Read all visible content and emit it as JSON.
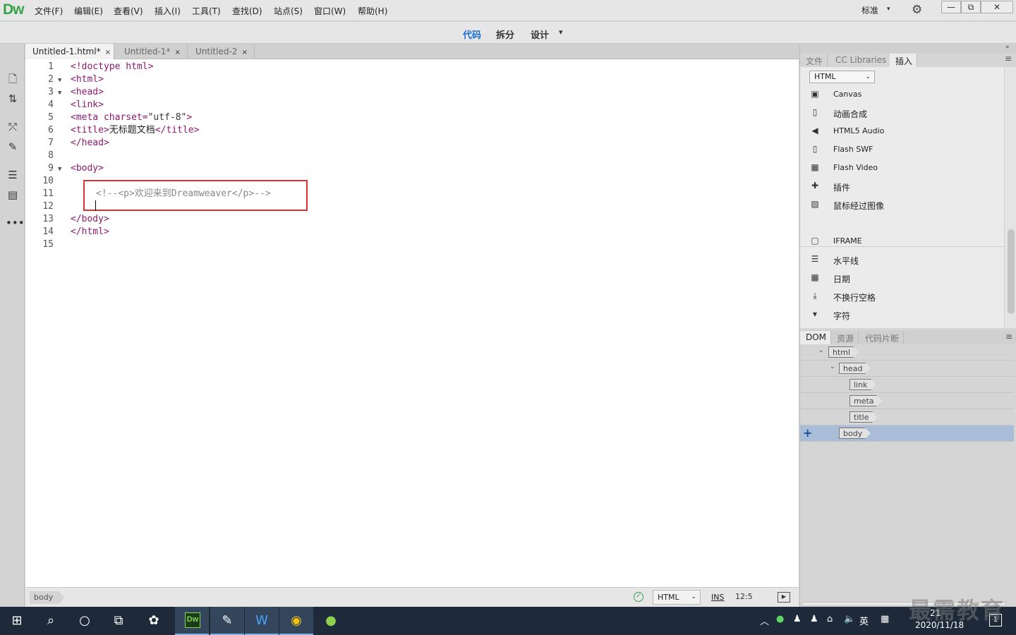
{
  "app": {
    "logo": "Dw"
  },
  "menu": [
    "文件(F)",
    "编辑(E)",
    "查看(V)",
    "插入(I)",
    "工具(T)",
    "查找(D)",
    "站点(S)",
    "窗口(W)",
    "帮助(H)"
  ],
  "workspace": {
    "label": "标准",
    "caret": "▾"
  },
  "window_controls": {
    "minimize": "—",
    "restore": "⧉",
    "close": "✕"
  },
  "view_modes": {
    "code": "代码",
    "split": "拆分",
    "design": "设计",
    "caret": "▾",
    "active": "代码",
    "active_color": "#1a6fd6"
  },
  "doc_tabs": [
    {
      "label": "Untitled-1.html*",
      "close": "×",
      "active": true
    },
    {
      "label": "Untitled-1*",
      "close": "×",
      "active": false
    },
    {
      "label": "Untitled-2",
      "close": "×",
      "active": false
    }
  ],
  "code": {
    "line_numbers": [
      "1",
      "2",
      "3",
      "4",
      "5",
      "6",
      "7",
      "8",
      "9",
      "10",
      "11",
      "12",
      "13",
      "14",
      "15"
    ],
    "l1": "<!doctype html>",
    "l2": "<html>",
    "l3": "<head>",
    "l4": "<link>",
    "l5_tag": "<meta ",
    "l5_attr": "charset=",
    "l5_val": "\"utf-8\"",
    "l5_end": ">",
    "l6_open": "<title>",
    "l6_text": "无标题文档",
    "l6_close": "</title>",
    "l7": "</head>",
    "l9": "<body>",
    "l11": "<!--<p>欢迎来到Dreamweaver</p>-->",
    "l13": "</body>",
    "l14": "</html>",
    "fold_marker": "▼"
  },
  "status_bar": {
    "tag": "body",
    "ok": "✓",
    "language": "HTML",
    "caret": "⌄",
    "mode": "INS",
    "position": "12:5"
  },
  "right_panel": {
    "tabs": [
      "文件",
      "CC Libraries",
      "插入"
    ],
    "menu_icon": "≡",
    "collapse": "»",
    "insert_category": "HTML",
    "insert_items": [
      {
        "label": "Canvas",
        "icon": "canvas-icon"
      },
      {
        "label": "动画合成",
        "icon": "animation-icon"
      },
      {
        "label": "HTML5 Audio",
        "icon": "speaker-icon"
      },
      {
        "label": "Flash SWF",
        "icon": "flash-file-icon"
      },
      {
        "label": "Flash Video",
        "icon": "film-icon"
      },
      {
        "label": "插件",
        "icon": "puzzle-icon"
      },
      {
        "label": "鼠标经过图像",
        "icon": "rollover-image-icon"
      },
      {
        "label": "IFRAME",
        "icon": "iframe-icon"
      },
      {
        "label": "水平线",
        "icon": "horizontal-rule-icon"
      },
      {
        "label": "日期",
        "icon": "calendar-icon"
      },
      {
        "label": "不换行空格",
        "icon": "download-arrow-icon"
      },
      {
        "label": "字符",
        "icon": "character-icon"
      }
    ],
    "dom_tabs": [
      "DOM",
      "资源",
      "代码片断"
    ],
    "dom_tree": [
      {
        "tag": "html",
        "level": 0,
        "expanded": true
      },
      {
        "tag": "head",
        "level": 1,
        "expanded": true
      },
      {
        "tag": "link",
        "level": 2
      },
      {
        "tag": "meta",
        "level": 2
      },
      {
        "tag": "title",
        "level": 2
      },
      {
        "tag": "body",
        "level": 1,
        "selected": true
      }
    ],
    "dom_add": "+"
  },
  "watermark": "最需教育",
  "taskbar": {
    "dw_label": "Dw",
    "tray_lang": "英",
    "clock_time": "21",
    "clock_date": "2020/11/18",
    "notifications": "1"
  }
}
